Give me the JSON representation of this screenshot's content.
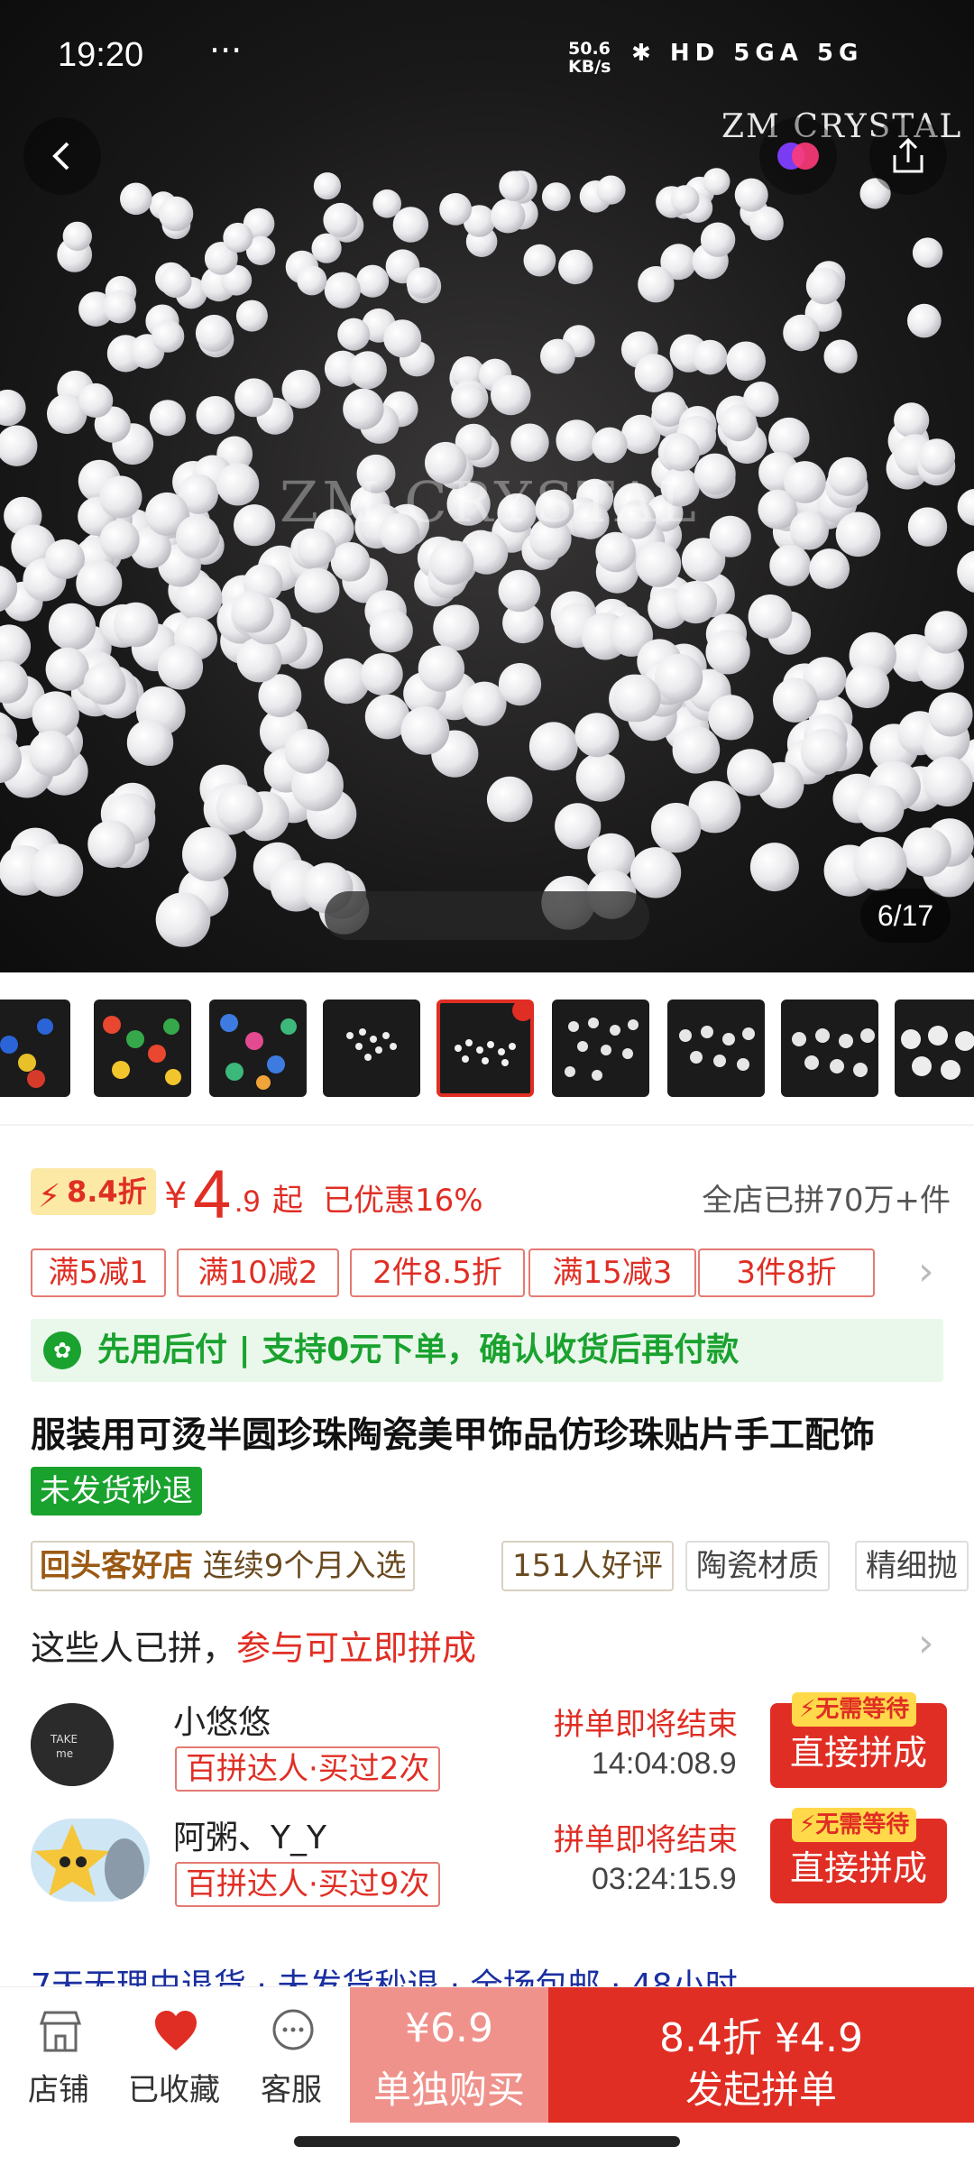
{
  "status_bar": {
    "time": "19:20",
    "more": "···",
    "net_speed_value": "50.6",
    "net_speed_unit": "KB/s",
    "signal": "5GA 5G",
    "hd": "HD"
  },
  "hero": {
    "watermark_brand": "ZM CRYSTAL",
    "watermark_center": "ZM CRYSTAL",
    "pager": "6/17"
  },
  "price": {
    "discount_tag": "8.4折",
    "currency": "¥",
    "integer": "4",
    "decimal": ".9",
    "qi": "起",
    "saved": "已优惠16%",
    "sold": "全店已拼70万+件"
  },
  "coupons": [
    "满5减1",
    "满10减2",
    "2件8.5折",
    "满15减3",
    "3件8折"
  ],
  "pay_later": "先用后付 | 支持0元下单，确认收货后再付款",
  "product_title": "服装用可烫半圆珍珠陶瓷美甲饰品仿珍珠贴片手工配饰",
  "refund_badge": "未发货秒退",
  "tags": {
    "repeat_shop": "回头客好店",
    "streak": "连续9个月入选",
    "reviews": "151人好评",
    "material": "陶瓷材质",
    "polish": "精细抛"
  },
  "group": {
    "head_plain": "这些人已拼，",
    "head_red": "参与可立即拼成",
    "rows": [
      {
        "name": "小悠悠",
        "info": "百拼达人·买过2次",
        "ending": "拼单即将结束",
        "timer": "14:04:08.9",
        "badge": "无需等待",
        "button": "直接拼成"
      },
      {
        "name": "阿粥、Y_Y",
        "info": "百拼达人·买过9次",
        "ending": "拼单即将结束",
        "timer": "03:24:15.9",
        "badge": "无需等待",
        "button": "直接拼成"
      }
    ]
  },
  "peek_line": "7天无理由退货 · 未发货秒退 · 全场包邮 · 48小时",
  "bottom": {
    "shop": "店铺",
    "fav": "已收藏",
    "service": "客服",
    "single_price": "¥6.9",
    "single_label": "单独购买",
    "group_price": "8.4折 ¥4.9",
    "group_label": "发起拼单"
  },
  "colors": {
    "accent": "#e02e24",
    "green": "#1aa22f",
    "light_red": "#f0928c"
  }
}
